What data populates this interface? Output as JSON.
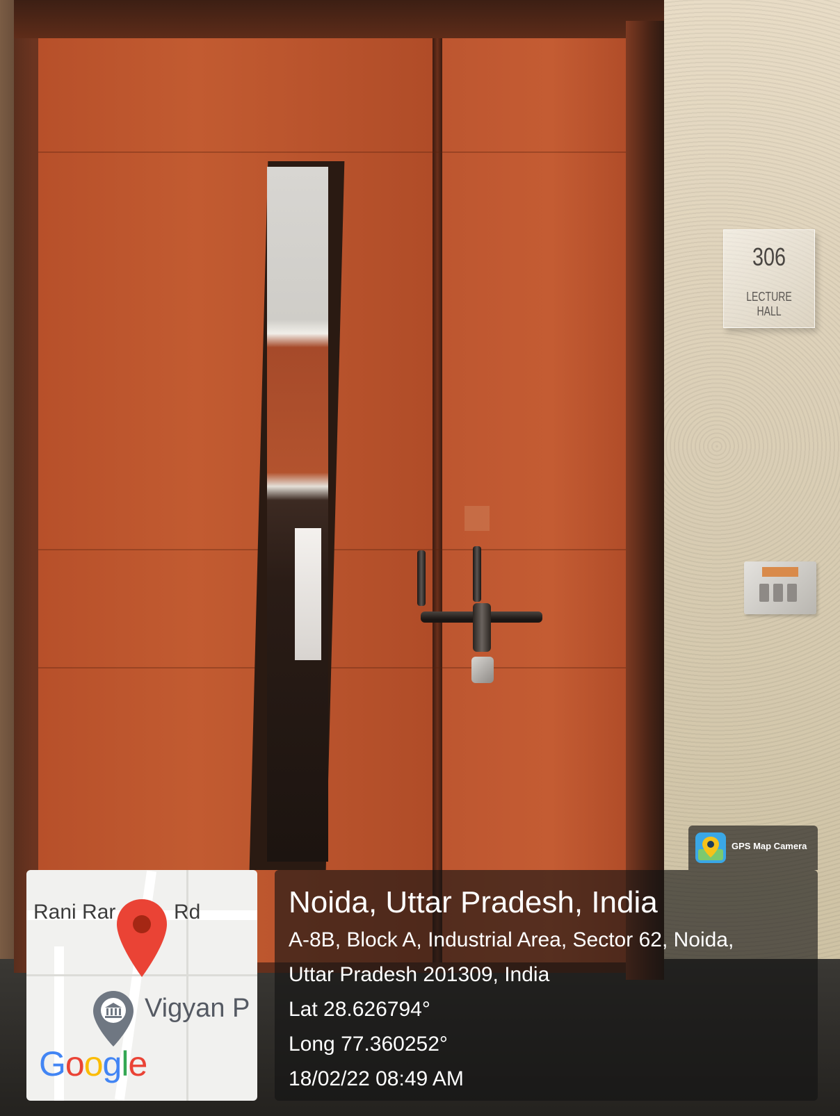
{
  "scene": {
    "sign": {
      "room_number": "306",
      "room_name": "LECTURE HALL"
    }
  },
  "map_card": {
    "road_label_left": "Rani Rar",
    "road_label_right": "Rd",
    "poi_label": "Vigyan P",
    "logo_text": "Google",
    "logo_colors": [
      "#4285F4",
      "#EA4335",
      "#FBBC05",
      "#4285F4",
      "#34A853",
      "#EA4335"
    ],
    "pin_color": "#EA4335",
    "poi_icon": "museum-icon"
  },
  "app_badge": {
    "name": "GPS Map Camera",
    "icon": "gps-camera-icon"
  },
  "info_card": {
    "title": "Noida, Uttar Pradesh, India",
    "address_line_1": "A-8B, Block A, Industrial Area, Sector 62, Noida,",
    "address_line_2": "Uttar Pradesh 201309, India",
    "latitude": "Lat 28.626794°",
    "longitude": "Long 77.360252°",
    "datetime": "18/02/22 08:49 AM"
  }
}
